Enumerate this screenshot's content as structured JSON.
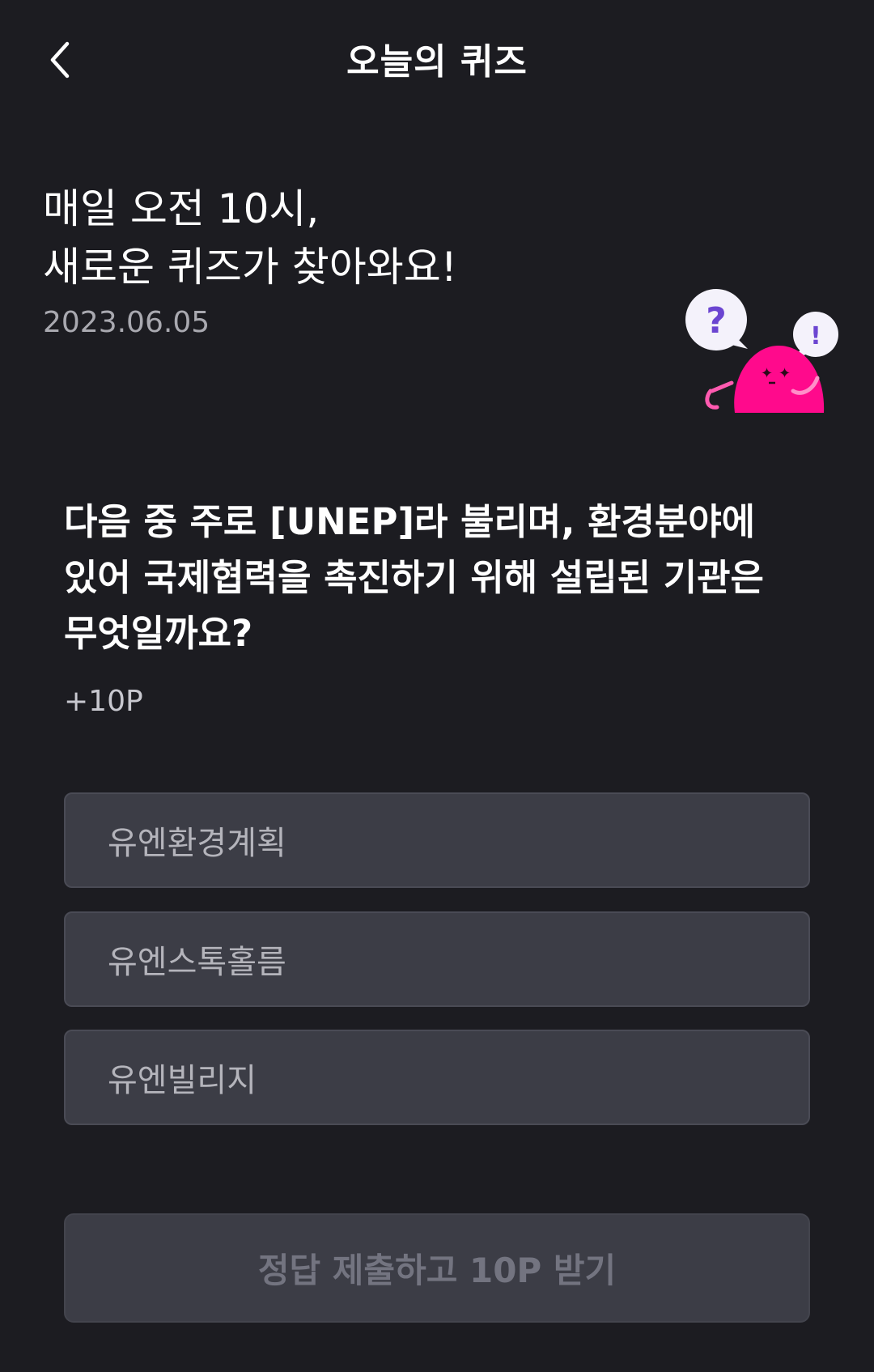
{
  "header": {
    "title": "오늘의 퀴즈",
    "back_icon": "chevron-left-icon"
  },
  "intro": {
    "line1": "매일 오전 10시,",
    "line2": "새로운 퀴즈가 찾아와요!",
    "date": "2023.06.05"
  },
  "mascot": {
    "bubble1": "?",
    "bubble2": "!",
    "body_color": "#ff0a8c",
    "accent_color": "#6b45d1"
  },
  "quiz": {
    "question": "다음 중 주로 [UNEP]라 불리며, 환경분야에 있어 국제협력을 촉진하기 위해 설립된 기관은 무엇일까요?",
    "points": "+10P",
    "options": [
      {
        "label": "유엔환경계획"
      },
      {
        "label": "유엔스톡홀름"
      },
      {
        "label": "유엔빌리지"
      }
    ],
    "submit_label": "정답 제출하고 10P 받기"
  },
  "colors": {
    "background": "#1c1c21",
    "option_bg": "#3c3d46",
    "option_text": "#b4b4bb",
    "disabled_text": "#737480"
  }
}
